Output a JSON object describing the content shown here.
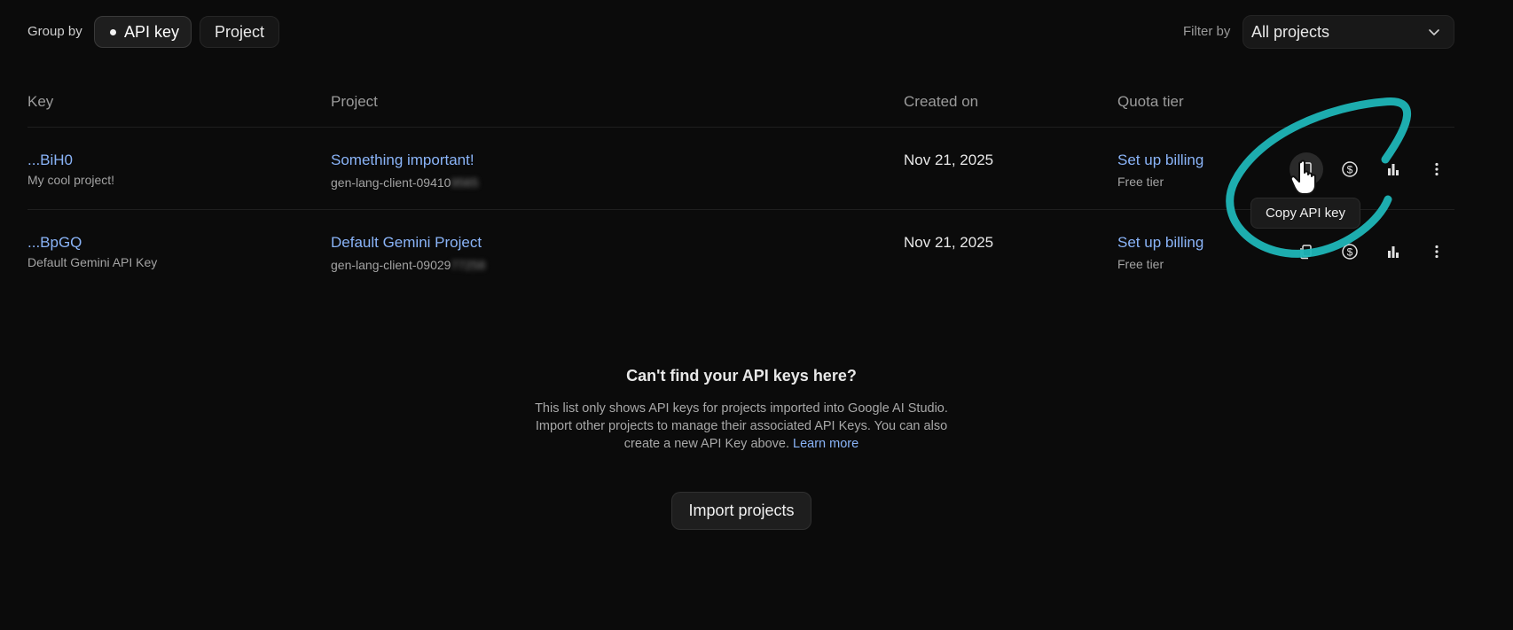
{
  "toolbar": {
    "group_by_label": "Group by",
    "chips": [
      {
        "label": "API key",
        "active": true
      },
      {
        "label": "Project",
        "active": false
      }
    ],
    "filter_label": "Filter by",
    "filter_value": "All projects"
  },
  "table": {
    "headers": [
      "Key",
      "Project",
      "Created on",
      "Quota tier"
    ],
    "rows": [
      {
        "key": "...BiH0",
        "key_name": "My cool project!",
        "project": "Something important!",
        "client_prefix": "gen-lang-client-09410",
        "client_hidden": "9565",
        "created": "Nov 21, 2025",
        "billing": "Set up billing",
        "tier": "Free tier"
      },
      {
        "key": "...BpGQ",
        "key_name": "Default Gemini API Key",
        "project": "Default Gemini Project",
        "client_prefix": "gen-lang-client-09029",
        "client_hidden": "77258",
        "created": "Nov 21, 2025",
        "billing": "Set up billing",
        "tier": "Free tier"
      }
    ],
    "row_actions": [
      "copy-icon",
      "dollar-icon",
      "bar-chart-icon",
      "more-vert-icon"
    ]
  },
  "tooltip": "Copy API key",
  "empty_state": {
    "title": "Can't find your API keys here?",
    "body": "This list only shows API keys for projects imported into Google AI Studio. Import other projects to manage their associated API Keys. You can also create a new API Key above.",
    "learn_more": "Learn more",
    "import_button": "Import projects"
  },
  "colors": {
    "background": "#0b0b0b",
    "link": "#8ab4f8",
    "annotation": "#1fb6b8"
  }
}
